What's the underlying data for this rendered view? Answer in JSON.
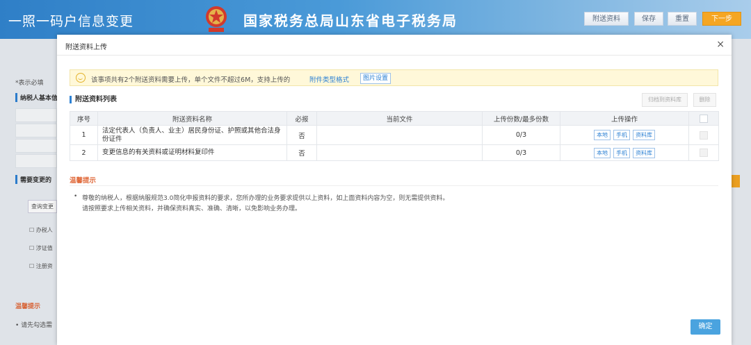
{
  "header": {
    "app_title": "一照一码户信息变更",
    "site_title": "国家税务总局山东省电子税务局",
    "buttons": {
      "attach": "附送资料",
      "save": "保存",
      "reset": "重置",
      "next": "下一步"
    }
  },
  "background": {
    "required_note": "*表示必填",
    "section1": "纳税人基本信",
    "section2": "需要变更的",
    "query_button": "查询变更",
    "checks": [
      "办税人",
      "涉证值",
      "注册资"
    ],
    "tip_title": "温馨提示",
    "tip_item": "• 请先勾选需"
  },
  "modal": {
    "title": "附送资料上传",
    "close": "×",
    "notice": {
      "text": "该事项共有2个附送资料需要上传，单个文件不超过6M，支持上传的",
      "link": "附件类型格式",
      "button": "图片设置"
    },
    "list_title": "附送资料列表",
    "toolbar": {
      "archive": "归档到资料库",
      "delete": "删除"
    },
    "table": {
      "headers": [
        "序号",
        "附送资料名称",
        "必报",
        "当前文件",
        "上传份数/最多份数",
        "上传操作"
      ],
      "rows": [
        {
          "no": "1",
          "name": "法定代表人（负责人、业主）居民身份证、护照或其他合法身份证件",
          "required": "否",
          "file": "",
          "count": "0/3"
        },
        {
          "no": "2",
          "name": "变更信息的有关资料或证明材料复印件",
          "required": "否",
          "file": "",
          "count": "0/3"
        }
      ],
      "upload_buttons": [
        "本地",
        "手机",
        "资料库"
      ]
    },
    "tips": {
      "title": "温馨提示",
      "bullet": "•",
      "line1": "尊敬的纳税人，根据纳服规范3.0简化申报资料的要求，您所办理的业务要求提供以上资料，如上面资料内容为空，则无需提供资料。",
      "line2": "请按照要求上传相关资料，并确保资料真实、准确、清晰，以免影响业务办理。"
    },
    "ok_button": "确定"
  },
  "colors": {
    "accent": "#2e82d4",
    "next_button": "#f5a623",
    "tip_title": "#e06a3b",
    "ok_button": "#4aa3df"
  }
}
